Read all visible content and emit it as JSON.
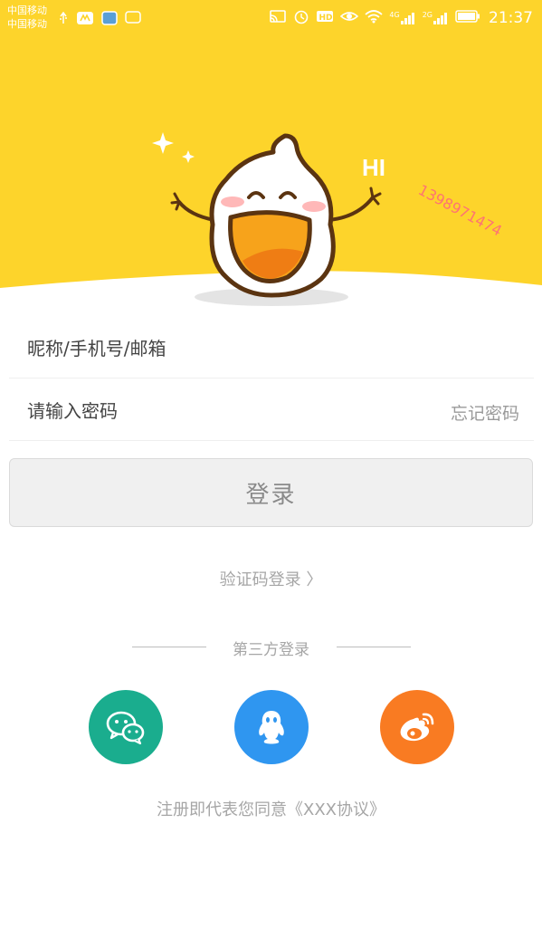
{
  "status_bar": {
    "carrier_1": "中国移动",
    "carrier_2": "中国移动",
    "network_1": "4G",
    "network_2": "2G",
    "time": "21:37"
  },
  "header": {
    "greeting": "HI",
    "watermark": "1398971474",
    "background_color": "#fdd42b"
  },
  "form": {
    "account_placeholder": "昵称/手机号/邮箱",
    "password_placeholder": "请输入密码",
    "forgot_password": "忘记密码",
    "login_button": "登录",
    "code_login": "验证码登录 〉"
  },
  "third_party": {
    "label": "第三方登录",
    "items": [
      {
        "name": "wechat",
        "icon": "wechat-icon",
        "color": "#1aad8e"
      },
      {
        "name": "qq",
        "icon": "qq-icon",
        "color": "#2f96f0"
      },
      {
        "name": "weibo",
        "icon": "weibo-icon",
        "color": "#f97b22"
      }
    ]
  },
  "agreement": "注册即代表您同意《XXX协议》"
}
